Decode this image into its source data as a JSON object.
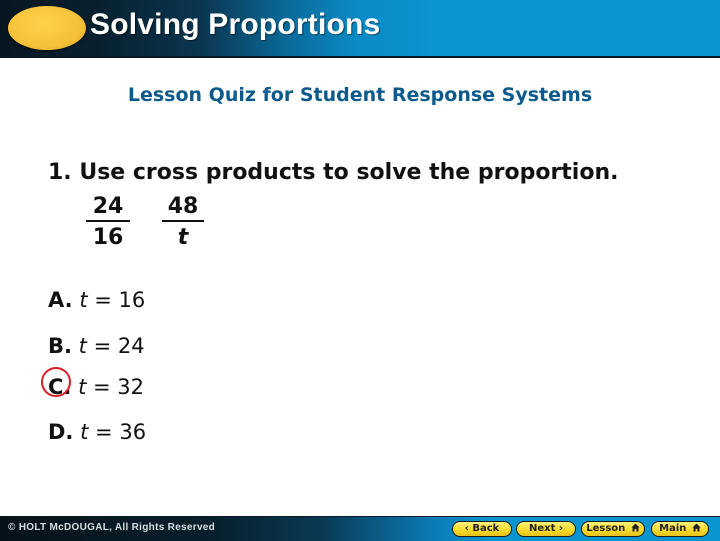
{
  "header": {
    "title": "Solving Proportions",
    "accent_color": "#0a94d0",
    "oval_color": "#f7c13a"
  },
  "subtitle": "Lesson Quiz for Student Response Systems",
  "question": {
    "text": "1. Use cross products to solve the proportion.",
    "fraction_left": {
      "numerator": "24",
      "denominator": "16"
    },
    "fraction_right": {
      "numerator": "48",
      "denominator": "t"
    }
  },
  "options": [
    {
      "letter": "A.",
      "variable": "t",
      "equals": "=",
      "value": "16",
      "selected": false
    },
    {
      "letter": "B.",
      "variable": "t",
      "equals": "=",
      "value": "24",
      "selected": false
    },
    {
      "letter": "C.",
      "variable": "t",
      "equals": "=",
      "value": "32",
      "selected": true
    },
    {
      "letter": "D.",
      "variable": "t",
      "equals": "=",
      "value": "36",
      "selected": false
    }
  ],
  "selection_color": "#d81e26",
  "footer": {
    "copyright": "© HOLT McDOUGAL, All Rights Reserved",
    "nav": {
      "back_label": "Back",
      "back_icon": "chevron-left-icon",
      "next_label": "Next",
      "next_icon": "chevron-right-icon",
      "lesson_label": "Lesson",
      "lesson_icon": "home-icon",
      "main_label": "Main",
      "main_icon": "home-icon"
    }
  }
}
